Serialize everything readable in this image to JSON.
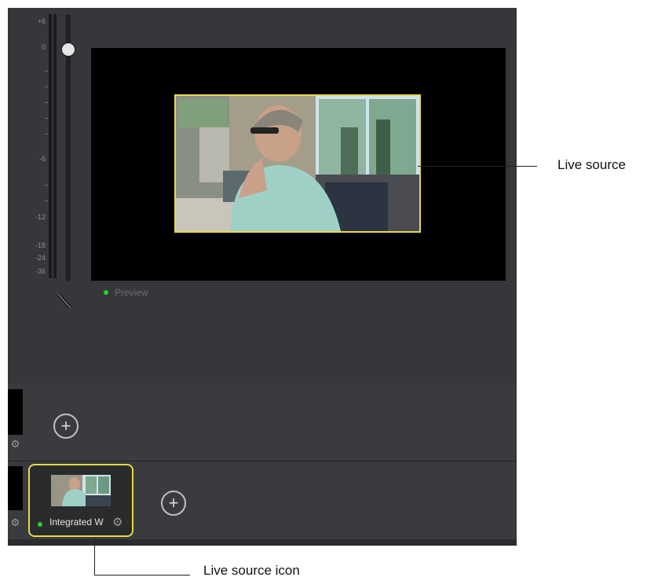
{
  "meter": {
    "ticks": [
      "+6",
      "0",
      "-6",
      "-12",
      "-18",
      "-24",
      "-36"
    ],
    "volume_level_fraction": 0.85
  },
  "preview": {
    "label": "Preview"
  },
  "source_tile": {
    "label": "Integrated W"
  },
  "add_button_glyph": "+",
  "gear_glyph": "⚙",
  "callouts": {
    "live_source": "Live source",
    "live_source_icon": "Live source icon"
  },
  "colors": {
    "highlight_border": "#e8d84a",
    "live_indicator": "#2bd02b",
    "canvas_background": "#000000"
  },
  "icons": [
    "mute-slash-icon",
    "gear-icon",
    "add-icon",
    "live-indicator-dot"
  ]
}
